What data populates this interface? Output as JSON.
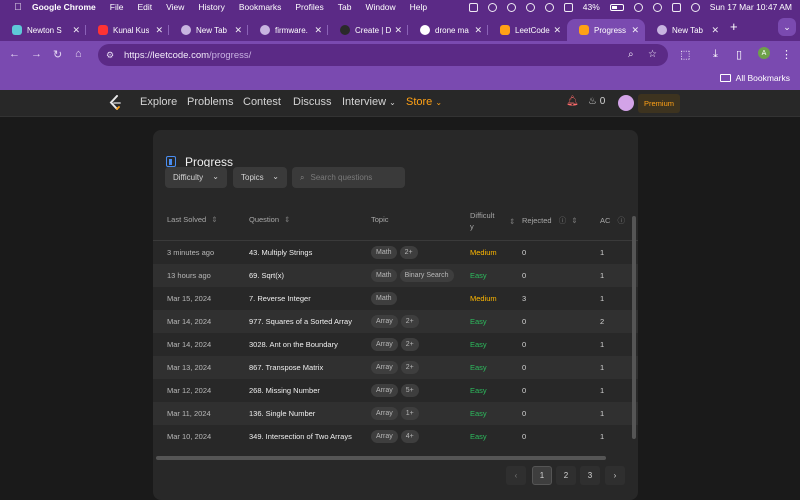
{
  "menubar": {
    "app": "Google Chrome",
    "items": [
      "File",
      "Edit",
      "View",
      "History",
      "Bookmarks",
      "Profiles",
      "Tab",
      "Window",
      "Help"
    ],
    "battery": "43%",
    "datetime": "Sun 17 Mar  10:47 AM"
  },
  "tabs": [
    {
      "label": "Newton S",
      "favicon_color": "#5ec8d8"
    },
    {
      "label": "Kunal Kus",
      "favicon_color": "#ff3333"
    },
    {
      "label": "New Tab",
      "favicon_color": "#c8b4e0"
    },
    {
      "label": "firmware.",
      "favicon_color": "#c8b4e0"
    },
    {
      "label": "Create | D",
      "favicon_color": "#2a2a2a"
    },
    {
      "label": "drone ma",
      "favicon_color": "#ffffff"
    },
    {
      "label": "LeetCode",
      "favicon_color": "#ffa116"
    },
    {
      "label": "Progress",
      "favicon_color": "#ffa116",
      "active": true
    },
    {
      "label": "New Tab",
      "favicon_color": "#c8b4e0"
    }
  ],
  "address": {
    "scheme_host": "https://leetcode.com",
    "path": "/progress/"
  },
  "bookmarks": {
    "all_label": "All Bookmarks"
  },
  "profile_initial": "A",
  "lcnav": {
    "links": [
      "Explore",
      "Problems",
      "Contest",
      "Discuss"
    ],
    "interview": "Interview",
    "store": "Store",
    "streak": "0",
    "premium": "Premium"
  },
  "progress": {
    "title": "Progress",
    "filters": {
      "difficulty": "Difficulty",
      "topics": "Topics",
      "search_placeholder": "Search questions"
    },
    "headers": {
      "last_solved": "Last Solved",
      "question": "Question",
      "topic": "Topic",
      "difficulty_line1": "Difficult",
      "difficulty_line2": "y",
      "rejected": "Rejected",
      "ac": "AC"
    },
    "rows": [
      {
        "date": "3 minutes ago",
        "question": "43. Multiply Strings",
        "tags": [
          "Math",
          "2+"
        ],
        "difficulty": "Medium",
        "rejected": "0",
        "ac": "1"
      },
      {
        "date": "13 hours ago",
        "question": "69. Sqrt(x)",
        "tags": [
          "Math",
          "Binary Search"
        ],
        "difficulty": "Easy",
        "rejected": "0",
        "ac": "1"
      },
      {
        "date": "Mar 15, 2024",
        "question": "7. Reverse Integer",
        "tags": [
          "Math"
        ],
        "difficulty": "Medium",
        "rejected": "3",
        "ac": "1"
      },
      {
        "date": "Mar 14, 2024",
        "question": "977. Squares of a Sorted Array",
        "tags": [
          "Array",
          "2+"
        ],
        "difficulty": "Easy",
        "rejected": "0",
        "ac": "2"
      },
      {
        "date": "Mar 14, 2024",
        "question": "3028. Ant on the Boundary",
        "tags": [
          "Array",
          "2+"
        ],
        "difficulty": "Easy",
        "rejected": "0",
        "ac": "1"
      },
      {
        "date": "Mar 13, 2024",
        "question": "867. Transpose Matrix",
        "tags": [
          "Array",
          "2+"
        ],
        "difficulty": "Easy",
        "rejected": "0",
        "ac": "1"
      },
      {
        "date": "Mar 12, 2024",
        "question": "268. Missing Number",
        "tags": [
          "Array",
          "5+"
        ],
        "difficulty": "Easy",
        "rejected": "0",
        "ac": "1"
      },
      {
        "date": "Mar 11, 2024",
        "question": "136. Single Number",
        "tags": [
          "Array",
          "1+"
        ],
        "difficulty": "Easy",
        "rejected": "0",
        "ac": "1"
      },
      {
        "date": "Mar 10, 2024",
        "question": "349. Intersection of Two Arrays",
        "tags": [
          "Array",
          "4+"
        ],
        "difficulty": "Easy",
        "rejected": "0",
        "ac": "1"
      }
    ],
    "pagination": {
      "prev": "‹",
      "pages": [
        "1",
        "2",
        "3"
      ],
      "next": "›",
      "current": "1"
    }
  },
  "colors": {
    "easy": "#2cbb5d",
    "medium": "#ffb800",
    "accent": "#ffa116",
    "chrome": "#5b2a86"
  }
}
